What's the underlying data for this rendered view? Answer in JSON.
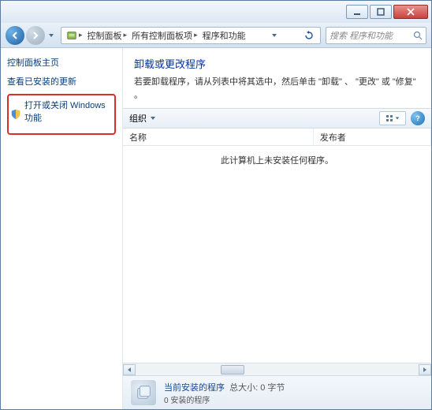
{
  "breadcrumb": {
    "seg1": "控制面板",
    "seg2": "所有控制面板项",
    "seg3": "程序和功能"
  },
  "search": {
    "placeholder": "搜索 程序和功能"
  },
  "sidebar": {
    "home": "控制面板主页",
    "updates": "查看已安装的更新",
    "features": "打开或关闭 Windows 功能"
  },
  "main": {
    "title": "卸载或更改程序",
    "desc": "若要卸载程序，请从列表中将其选中，然后单击 \"卸载\" 、 \"更改\" 或 \"修复\" 。"
  },
  "toolbar": {
    "organize": "组织"
  },
  "columns": {
    "name": "名称",
    "publisher": "发布者"
  },
  "list": {
    "empty": "此计算机上未安装任何程序。"
  },
  "footer": {
    "title": "当前安装的程序",
    "size_label": "总大小:",
    "size_value": "0 字节",
    "count": "0 安装的程序"
  }
}
